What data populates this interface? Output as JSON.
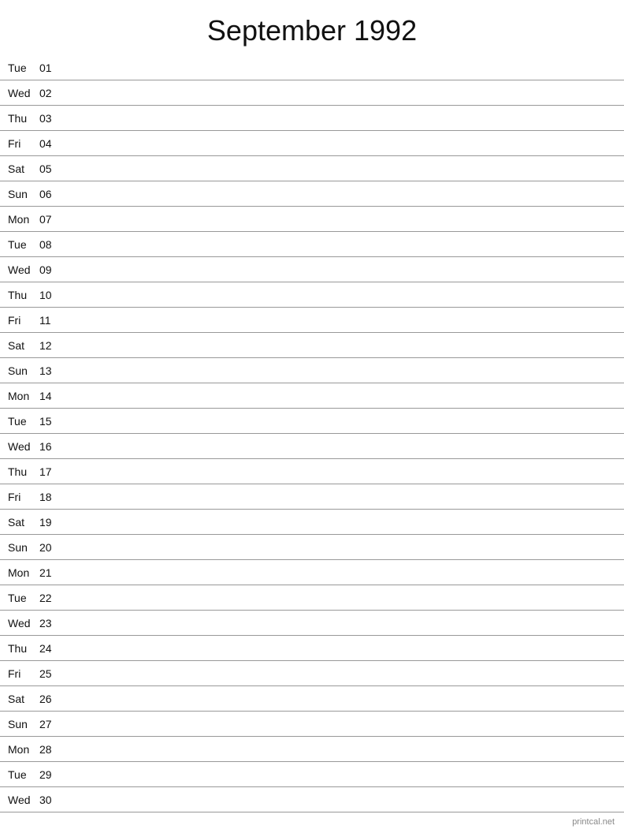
{
  "title": "September 1992",
  "days": [
    {
      "name": "Tue",
      "number": "01"
    },
    {
      "name": "Wed",
      "number": "02"
    },
    {
      "name": "Thu",
      "number": "03"
    },
    {
      "name": "Fri",
      "number": "04"
    },
    {
      "name": "Sat",
      "number": "05"
    },
    {
      "name": "Sun",
      "number": "06"
    },
    {
      "name": "Mon",
      "number": "07"
    },
    {
      "name": "Tue",
      "number": "08"
    },
    {
      "name": "Wed",
      "number": "09"
    },
    {
      "name": "Thu",
      "number": "10"
    },
    {
      "name": "Fri",
      "number": "11"
    },
    {
      "name": "Sat",
      "number": "12"
    },
    {
      "name": "Sun",
      "number": "13"
    },
    {
      "name": "Mon",
      "number": "14"
    },
    {
      "name": "Tue",
      "number": "15"
    },
    {
      "name": "Wed",
      "number": "16"
    },
    {
      "name": "Thu",
      "number": "17"
    },
    {
      "name": "Fri",
      "number": "18"
    },
    {
      "name": "Sat",
      "number": "19"
    },
    {
      "name": "Sun",
      "number": "20"
    },
    {
      "name": "Mon",
      "number": "21"
    },
    {
      "name": "Tue",
      "number": "22"
    },
    {
      "name": "Wed",
      "number": "23"
    },
    {
      "name": "Thu",
      "number": "24"
    },
    {
      "name": "Fri",
      "number": "25"
    },
    {
      "name": "Sat",
      "number": "26"
    },
    {
      "name": "Sun",
      "number": "27"
    },
    {
      "name": "Mon",
      "number": "28"
    },
    {
      "name": "Tue",
      "number": "29"
    },
    {
      "name": "Wed",
      "number": "30"
    }
  ],
  "footer": "printcal.net"
}
